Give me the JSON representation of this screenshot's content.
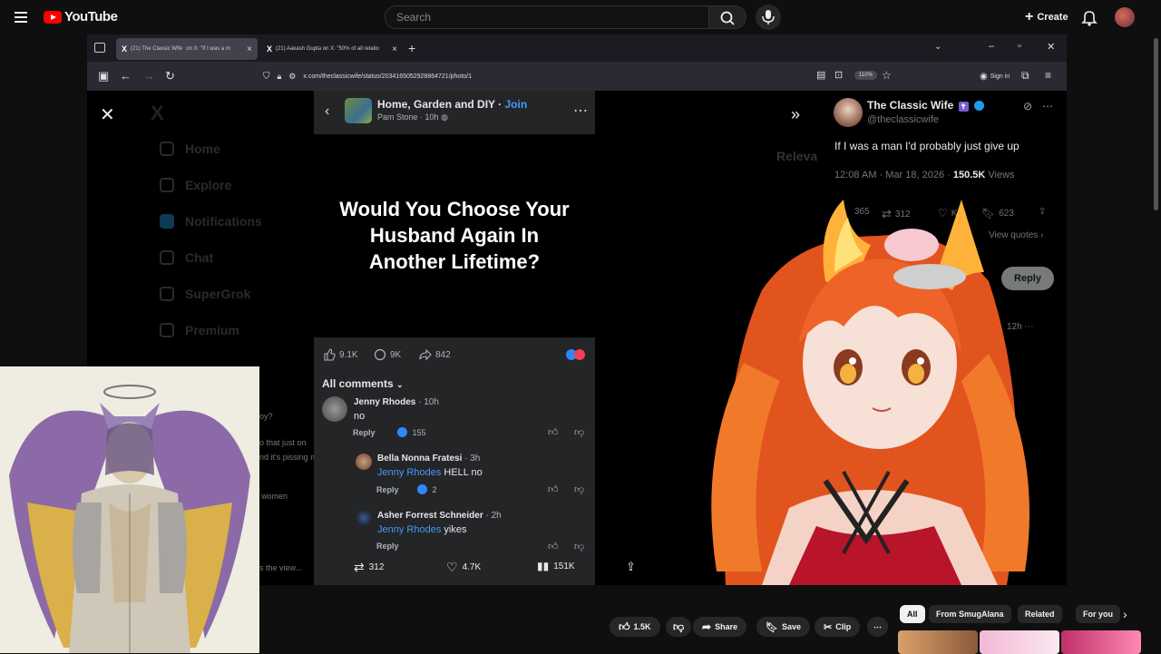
{
  "youtube": {
    "logo_text": "YouTube",
    "search_placeholder": "Search",
    "create_label": "Create",
    "actions": {
      "like_count": "1.5K",
      "share_label": "Share",
      "save_label": "Save",
      "clip_label": "Clip"
    },
    "chips": [
      "All",
      "From SmugAlana",
      "Related",
      "For you"
    ]
  },
  "browser": {
    "tabs": [
      {
        "title": "(21) The Classic Wife",
        "subtitle": "on X: \"If I was a m",
        "active": true
      },
      {
        "title": "(21) Aakash Gupta on X: \"50% of all relatio",
        "active": false
      }
    ],
    "url": "x.com/theclassicwife/status/2034165052928864721/photo/1",
    "zoom": "110%",
    "signin_label": "Sign in"
  },
  "x_sidebar": {
    "items": [
      "Home",
      "Explore",
      "Notifications",
      "Chat",
      "SuperGrok",
      "Premium"
    ]
  },
  "fb_post": {
    "group_name": "Home, Garden and DIY",
    "join_label": "Join",
    "author": "Pam Stone",
    "age": "10h",
    "image_text": "Would You Choose Your Husband Again In Another Lifetime?",
    "likes": "9.1K",
    "comments": "9K",
    "shares": "842",
    "all_comments_label": "All comments",
    "comment_list": [
      {
        "name": "Jenny Rhodes",
        "age": "10h",
        "tag": "",
        "text": "no",
        "reply": "Reply",
        "likes": "155"
      },
      {
        "name": "Bella Nonna Fratesi",
        "age": "3h",
        "tag": "Jenny Rhodes",
        "text": "HELL no",
        "reply": "Reply",
        "likes": "2"
      },
      {
        "name": "Asher Forrest Schneider",
        "age": "2h",
        "tag": "Jenny Rhodes",
        "text": "yikes",
        "reply": "Reply",
        "likes": ""
      }
    ]
  },
  "dim_page": {
    "lines": [
      "oy?",
      "o that just on",
      "nd it's pissing me",
      "women",
      "s the view..."
    ],
    "relevant": "Releva"
  },
  "x_tweet": {
    "name": "The Classic Wife",
    "handle": "@theclassicwife",
    "text": "If I was a man I'd probably just give up",
    "time": "12:08 AM · Mar 18, 2026 · ",
    "views_count": "150.5K",
    "views_label": " Views",
    "replies": "365",
    "reposts": "312",
    "likes_partial": "K",
    "bookmarks": "623",
    "view_quotes": "View quotes",
    "reply_button": "Reply",
    "reply_age": "12h"
  },
  "x_bottom": {
    "reposts": "312",
    "likes": "4.7K",
    "views": "151K"
  }
}
